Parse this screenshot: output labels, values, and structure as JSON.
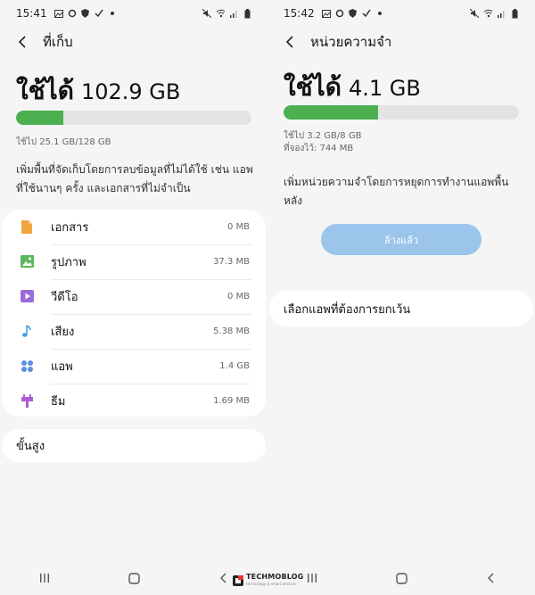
{
  "colors": {
    "background": "#f5f5f5",
    "card": "#ffffff",
    "bar_fill": "#4caf50",
    "bar_track": "#e3e3e3",
    "button": "#9cc5ec",
    "docs_icon": "#f2a640",
    "images_icon": "#5cb85c",
    "video_icon": "#9b6bdc",
    "audio_icon": "#3aa0e6",
    "apps_icon": "#5b8fe0",
    "themes_icon": "#b05bd6"
  },
  "left": {
    "status": {
      "time": "15:41"
    },
    "appbar": {
      "title": "ที่เก็บ"
    },
    "used_label": "ใช้ได้",
    "used_value": "102.9 GB",
    "progress_fraction": 0.2,
    "used_of_total": "ใช้ไป 25.1 GB/128 GB",
    "description": "เพิ่มพื้นที่จัดเก็บโดยการลบข้อมูลที่ไม่ได้ใช้ เช่น แอพที่ใช้นานๆ ครั้ง และเอกสารที่ไม่จำเป็น",
    "items": [
      {
        "label": "เอกสาร",
        "size": "0 MB",
        "icon": "document-icon"
      },
      {
        "label": "รูปภาพ",
        "size": "37.3 MB",
        "icon": "image-icon"
      },
      {
        "label": "วีดีโอ",
        "size": "0 MB",
        "icon": "video-icon"
      },
      {
        "label": "เสียง",
        "size": "5.38 MB",
        "icon": "music-note-icon"
      },
      {
        "label": "แอพ",
        "size": "1.4 GB",
        "icon": "apps-grid-icon"
      },
      {
        "label": "ธีม",
        "size": "1.69 MB",
        "icon": "theme-brush-icon"
      }
    ],
    "advanced_label": "ขั้นสูง"
  },
  "right": {
    "status": {
      "time": "15:42"
    },
    "appbar": {
      "title": "หน่วยความจำ"
    },
    "used_label": "ใช้ได้",
    "used_value": "4.1 GB",
    "progress_fraction": 0.4,
    "used_of_total": "ใช้ไป 3.2 GB/8 GB",
    "reserved": "ที่จองไว้: 744 MB",
    "description": "เพิ่มหน่วยความจำโดยการหยุดการทำงานแอพพื้นหลัง",
    "clean_button": "ล้างแล้ว",
    "exclude_label": "เลือกแอพที่ต้องการยกเว้น"
  },
  "watermark": {
    "main": "TECHMOBLOG",
    "sub": "technology & smart devices"
  }
}
